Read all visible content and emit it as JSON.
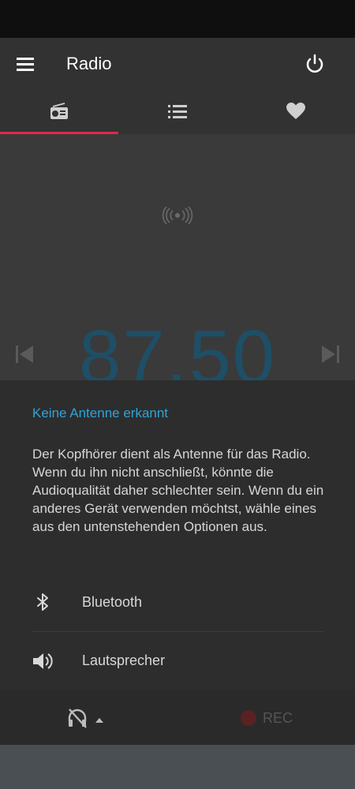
{
  "app": {
    "title": "Radio"
  },
  "tabs": [
    {
      "id": "radio",
      "icon": "radio-icon"
    },
    {
      "id": "list",
      "icon": "list-icon"
    },
    {
      "id": "favorites",
      "icon": "heart-icon"
    }
  ],
  "main": {
    "frequency": "87.50"
  },
  "sheet": {
    "title": "Keine Antenne erkannt",
    "body": "Der Kopfhörer dient als Antenne für das Radio. Wenn du ihn nicht anschließt, könnte die Audioqualität daher schlechter sein. Wenn du ein anderes Gerät verwenden möchtst, wähle eines aus den untenstehenden Optionen aus.",
    "options": [
      {
        "label": "Bluetooth",
        "icon": "bluetooth-icon"
      },
      {
        "label": "Lautsprecher",
        "icon": "speaker-icon"
      }
    ]
  },
  "bottom": {
    "rec_label": "REC"
  },
  "colors": {
    "accent": "#e02a4a",
    "link": "#2fa4d9",
    "frequency": "#1e4f66"
  }
}
